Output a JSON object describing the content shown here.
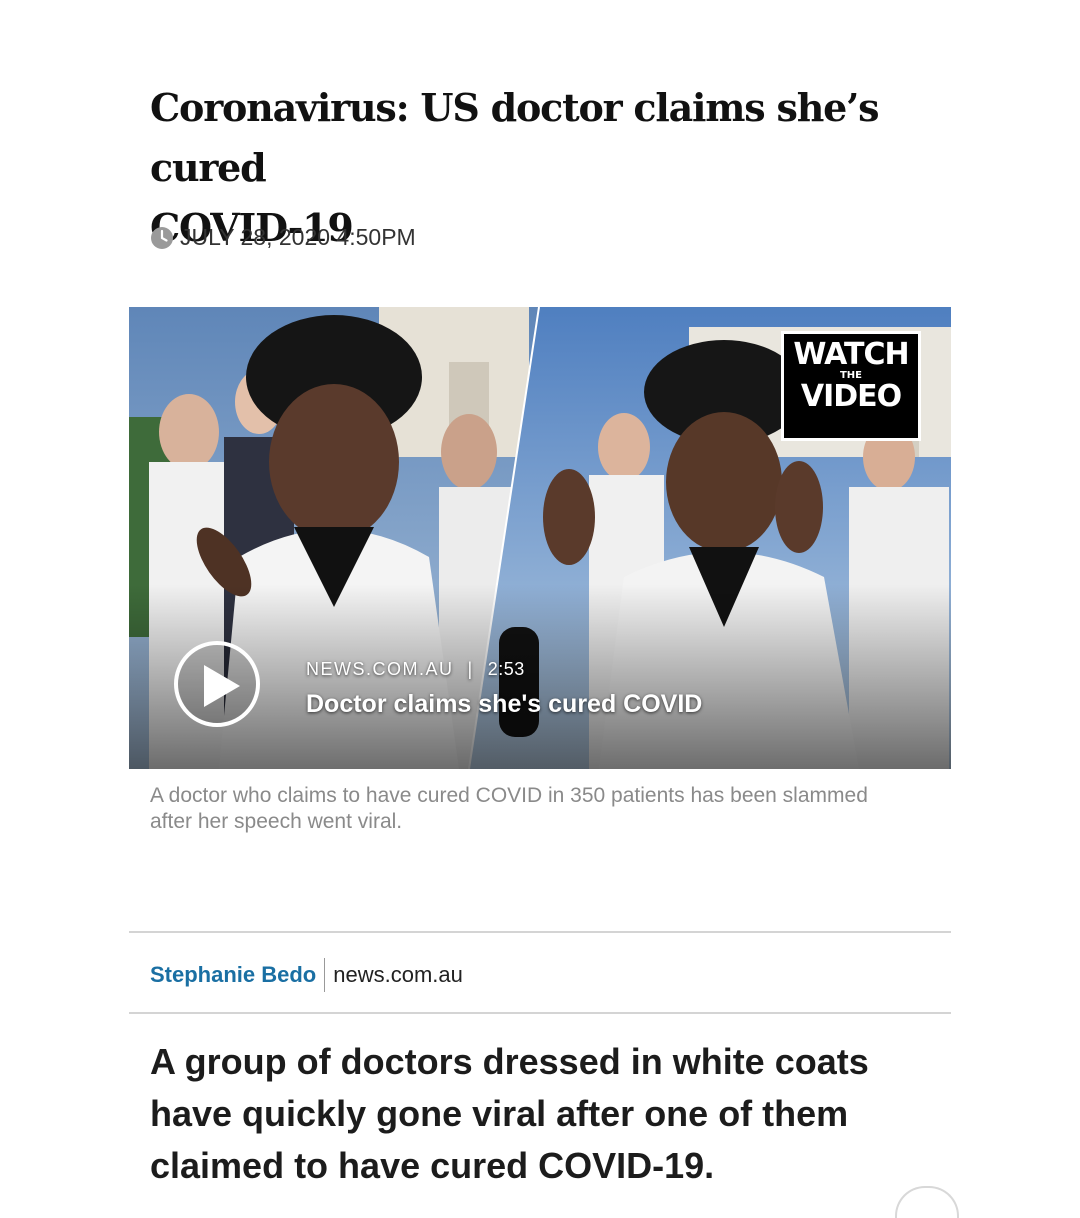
{
  "article": {
    "headline_line1": "Coronavirus: US doctor claims she’s cured",
    "headline_line2": "COVID-19",
    "date": "JULY 28, 2020 4:50PM",
    "date_icon": "clock-icon"
  },
  "video": {
    "badge_watch": "WATCH",
    "badge_the": "THE",
    "badge_video": "VIDEO",
    "source": "NEWS.COM.AU",
    "separator": "|",
    "duration": "2:53",
    "title": "Doctor claims she's cured COVID",
    "play_icon": "play-icon",
    "caption": "A doctor who claims to have cured COVID in 350 patients has been slammed after her speech went viral."
  },
  "byline": {
    "author": "Stephanie Bedo",
    "source": "news.com.au"
  },
  "body": {
    "lede": "A group of doctors dressed in white coats have quickly gone viral after one of them claimed to have cured COVID-19."
  },
  "colors": {
    "author_link": "#1a6fa3",
    "caption_text": "#8a8a8a",
    "headline_text": "#111111"
  }
}
